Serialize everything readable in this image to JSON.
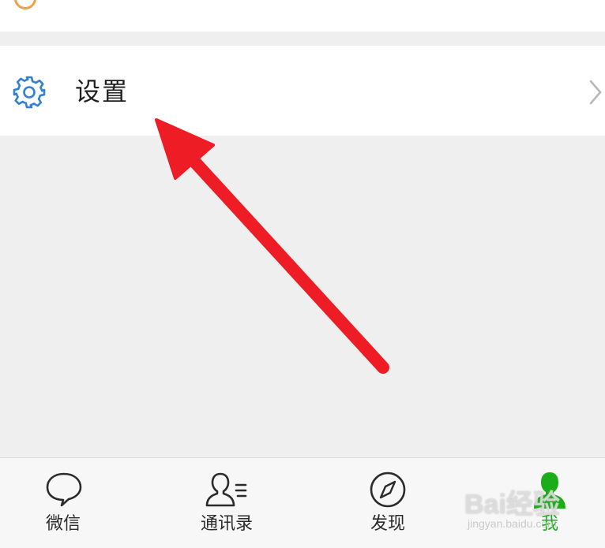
{
  "settings_row": {
    "label": "设置"
  },
  "tabbar": {
    "tabs": [
      {
        "label": "微信",
        "icon": "chat-bubble-icon",
        "active": false
      },
      {
        "label": "通讯录",
        "icon": "contacts-icon",
        "active": false
      },
      {
        "label": "发现",
        "icon": "compass-icon",
        "active": false
      },
      {
        "label": "我",
        "icon": "person-icon",
        "active": true
      }
    ]
  },
  "watermark": {
    "brand": "Bai经验",
    "sub": "jingyan.baidu.com"
  },
  "colors": {
    "accent_green": "#1aad19",
    "gear_blue": "#2f80d6",
    "arrow_red": "#ee1c24"
  }
}
